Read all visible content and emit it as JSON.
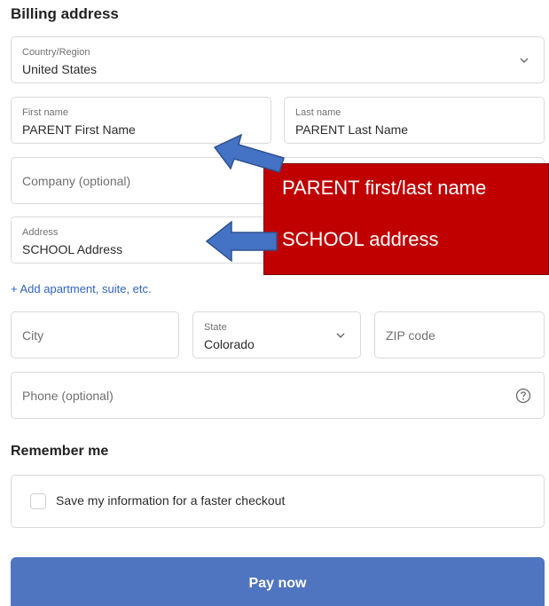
{
  "billing": {
    "heading": "Billing address",
    "country": {
      "label": "Country/Region",
      "value": "United States"
    },
    "first_name": {
      "label": "First name",
      "value": "PARENT First Name"
    },
    "last_name": {
      "label": "Last name",
      "value": "PARENT Last Name"
    },
    "company": {
      "placeholder": "Company (optional)"
    },
    "address": {
      "label": "Address",
      "value": "SCHOOL Address"
    },
    "add_apartment_link": "+ Add apartment, suite, etc.",
    "city": {
      "placeholder": "City"
    },
    "state": {
      "label": "State",
      "value": "Colorado"
    },
    "zip": {
      "placeholder": "ZIP code"
    },
    "phone": {
      "placeholder": "Phone (optional)"
    }
  },
  "remember": {
    "heading": "Remember me",
    "checkbox_label": "Save my information for a faster checkout",
    "checked": false
  },
  "pay_button": "Pay now",
  "annotation": {
    "line1": "PARENT first/last name",
    "line2": "SCHOOL address",
    "box_color": "#c00000",
    "arrow_color": "#4472c4"
  },
  "icons": {
    "dropdown": "chevron-down-icon",
    "help": "question-circle-icon"
  }
}
